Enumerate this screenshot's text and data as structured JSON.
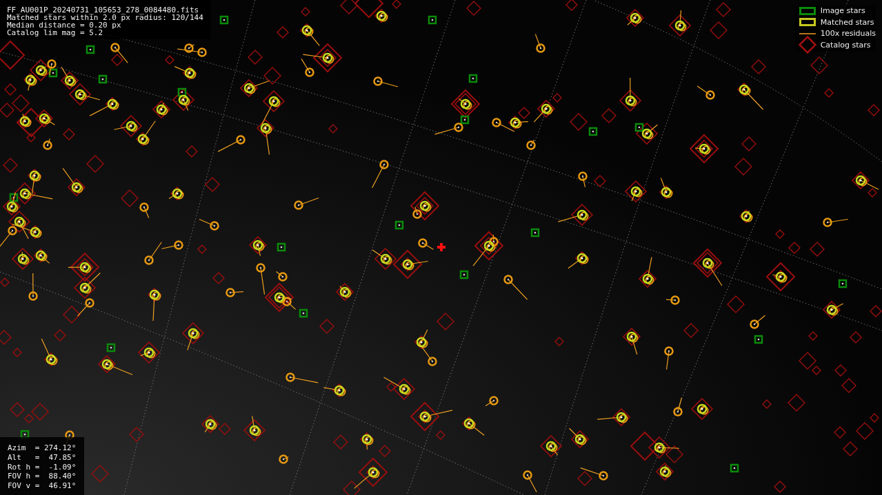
{
  "header": {
    "lines": [
      "FF_AU001P_20240731_105653_278_0084480.fits",
      "Matched stars within 2.0 px radius: 120/144",
      "Median distance = 0.20 px",
      "Catalog lim mag = 5.2"
    ]
  },
  "legend": [
    {
      "kind": "image",
      "label": "Image stars"
    },
    {
      "kind": "matched",
      "label": "Matched stars"
    },
    {
      "kind": "residual",
      "label": "100x residuals"
    },
    {
      "kind": "catalog",
      "label": "Catalog stars"
    }
  ],
  "pointing": {
    "lines": [
      "Azim  = 274.12°",
      "Alt   =  47.85°",
      "Rot h =  -1.09°",
      "FOV h =  88.40°",
      "FOV v =  46.91°"
    ]
  }
}
